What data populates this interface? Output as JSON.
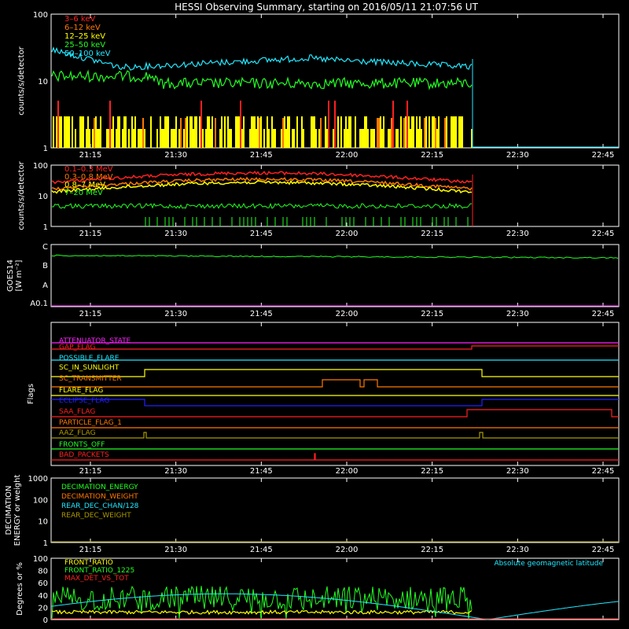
{
  "title": "HESSI Observing Summary, starting on 2016/05/11 21:07:56 UT",
  "time_ticks": [
    "21:15",
    "21:30",
    "21:45",
    "22:00",
    "22:15",
    "22:30",
    "22:45"
  ],
  "colors": {
    "red": "#ff2020",
    "orange": "#ff7800",
    "yellow": "#ffff00",
    "green": "#22ff22",
    "cyan": "#22e8ff",
    "magenta": "#ff22ff",
    "blue": "#2020ff",
    "olive": "#aa9900",
    "white": "#ffffff",
    "lightcyan": "#66ddff"
  },
  "chart_data": [
    {
      "id": "panel1",
      "type": "line",
      "scale": "log",
      "ylabel": "counts/s/detector",
      "ylim": [
        1,
        100
      ],
      "yticks": [
        "1",
        "10",
        "100"
      ],
      "series": [
        {
          "name": "3–6 keV",
          "color": "red",
          "level": 2.2
        },
        {
          "name": "6–12 keV",
          "color": "orange",
          "level": 2.4
        },
        {
          "name": "12–25 keV",
          "color": "yellow",
          "level": 2.6
        },
        {
          "name": "25–50 keV",
          "color": "green",
          "level": 7.5
        },
        {
          "name": "50–100 keV",
          "color": "cyan",
          "level": 16
        }
      ]
    },
    {
      "id": "panel2",
      "type": "line",
      "scale": "log",
      "ylabel": "counts/s/detector",
      "ylim": [
        1,
        100
      ],
      "yticks": [
        "1",
        "10",
        "100"
      ],
      "series": [
        {
          "name": "0.1–0.3 MeV",
          "color": "red",
          "level": 30
        },
        {
          "name": "0.3–0.8 MeV",
          "color": "orange",
          "level": 22
        },
        {
          "name": "0.8–7 MeV",
          "color": "yellow",
          "level": 18
        },
        {
          "name": "7–20 MeV",
          "color": "green",
          "level": 4
        }
      ]
    },
    {
      "id": "goes",
      "type": "line",
      "ylabel": "GOES14",
      "ylabel2": "[W m⁻²]",
      "yticks": [
        "A0.1",
        "A",
        "B",
        "C"
      ],
      "series": [
        {
          "name": "GOES14",
          "color": "green",
          "level": "B6"
        }
      ]
    },
    {
      "id": "flags",
      "type": "timeline",
      "ylabel": "Flags",
      "flags": [
        {
          "name": "ATTENUATOR_STATE",
          "color": "magenta"
        },
        {
          "name": "GAP_FLAG",
          "color": "red"
        },
        {
          "name": "POSSIBLE_FLARE",
          "color": "cyan"
        },
        {
          "name": "SC_IN_SUNLIGHT",
          "color": "yellow"
        },
        {
          "name": "SC_TRANSMITTER",
          "color": "orange"
        },
        {
          "name": "FLARE_FLAG",
          "color": "yellow"
        },
        {
          "name": "ECLIPSE_FLAG",
          "color": "blue"
        },
        {
          "name": "SAA_FLAG",
          "color": "red"
        },
        {
          "name": "PARTICLE_FLAG_1",
          "color": "orange"
        },
        {
          "name": "AAZ_FLAG",
          "color": "olive"
        },
        {
          "name": "FRONTS_OFF",
          "color": "green"
        },
        {
          "name": "BAD_PACKETS",
          "color": "red"
        }
      ]
    },
    {
      "id": "decimation",
      "type": "line",
      "scale": "log",
      "ylabel": "DECIMATION",
      "ylabel2": "ENERGY or weight",
      "ylim": [
        1,
        1000
      ],
      "yticks": [
        "1",
        "10",
        "100",
        "1000"
      ],
      "series": [
        {
          "name": "DECIMATION_ENERGY",
          "color": "green"
        },
        {
          "name": "DECIMATION_WEIGHT",
          "color": "orange"
        },
        {
          "name": "REAR_DEC_CHAN/128",
          "color": "cyan"
        },
        {
          "name": "REAR_DEC_WEIGHT",
          "color": "olive"
        }
      ]
    },
    {
      "id": "ratio",
      "type": "line",
      "ylabel": "Degrees or %",
      "ylim": [
        0,
        100
      ],
      "yticks": [
        "0",
        "20",
        "40",
        "60",
        "80",
        "100"
      ],
      "series": [
        {
          "name": "FRONT_RATIO",
          "color": "yellow"
        },
        {
          "name": "FRONT_RATIO_1225",
          "color": "green"
        },
        {
          "name": "MAX_DET_VS_TOT",
          "color": "red"
        }
      ],
      "annotation": "Absolute geomagnetic latitude"
    }
  ]
}
